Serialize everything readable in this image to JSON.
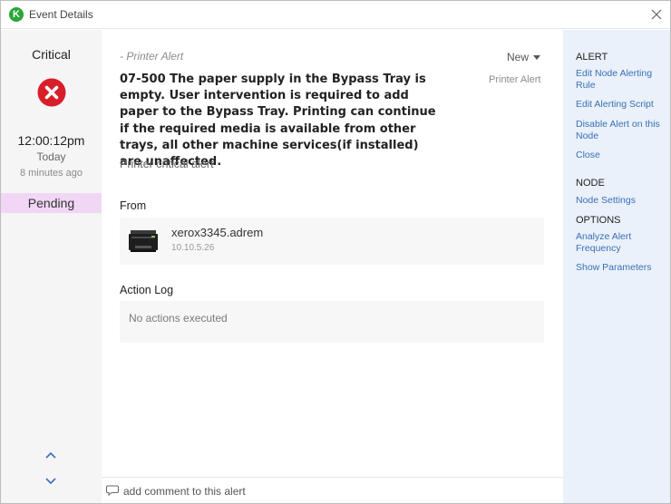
{
  "window": {
    "title": "Event Details",
    "logo_letter": "K"
  },
  "event": {
    "severity": "Critical",
    "time": "12:00:12pm",
    "day": "Today",
    "ago": "8 minutes ago",
    "status": "Pending",
    "alert_type": "- Printer Alert",
    "state": "New",
    "source": "Printer Alert",
    "message": "07-500 The paper supply in the Bypass Tray is empty. User intervention is required to add paper to the Bypass Tray. Printing can continue if the required media is available from other trays, all other machine services(if installed) are unaffected.",
    "sub_message": "Printer critical alert"
  },
  "from": {
    "label": "From",
    "node_name": "xerox3345.adrem",
    "node_ip": "10.10.5.26"
  },
  "action_log": {
    "label": "Action Log",
    "empty_text": "No actions executed"
  },
  "comment": {
    "placeholder": "add comment to this alert"
  },
  "sidebar": {
    "alert_heading": "ALERT",
    "alert_links": [
      "Edit Node Alerting Rule",
      "Edit Alerting Script",
      "Disable Alert on this Node",
      "Close"
    ],
    "node_heading": "NODE",
    "node_links": [
      "Node Settings"
    ],
    "options_heading": "OPTIONS",
    "options_links": [
      "Analyze Alert Frequency",
      "Show Parameters"
    ]
  },
  "colors": {
    "critical": "#d81e2a",
    "pending_bg": "#f1d6f5",
    "link": "#3a6fb5",
    "sidebar_bg": "#eaf1fb",
    "logo": "#2aa63a"
  }
}
